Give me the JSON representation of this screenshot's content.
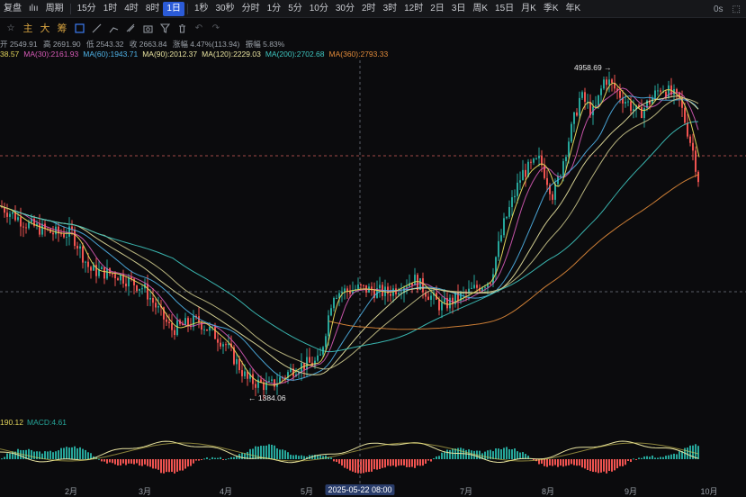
{
  "toolbar": {
    "items": [
      {
        "label": "复盘",
        "active": false
      },
      {
        "label": "ılıı",
        "active": false
      },
      {
        "label": "周期",
        "active": false
      },
      {
        "label": "15分",
        "active": false
      },
      {
        "label": "1时",
        "active": false
      },
      {
        "label": "4时",
        "active": false
      },
      {
        "label": "8时",
        "active": false
      },
      {
        "label": "1日",
        "active": true
      },
      {
        "label": "1秒",
        "active": false
      },
      {
        "label": "30秒",
        "active": false
      },
      {
        "label": "分时",
        "active": false
      },
      {
        "label": "1分",
        "active": false
      },
      {
        "label": "5分",
        "active": false
      },
      {
        "label": "10分",
        "active": false
      },
      {
        "label": "30分",
        "active": false
      },
      {
        "label": "2时",
        "active": false
      },
      {
        "label": "3时",
        "active": false
      },
      {
        "label": "12时",
        "active": false
      },
      {
        "label": "2日",
        "active": false
      },
      {
        "label": "3日",
        "active": false
      },
      {
        "label": "周K",
        "active": false
      },
      {
        "label": "15日",
        "active": false
      },
      {
        "label": "月K",
        "active": false
      },
      {
        "label": "季K",
        "active": false
      },
      {
        "label": "年K",
        "active": false
      }
    ],
    "countdown": "0s"
  },
  "toolbar2": {
    "buttons": [
      {
        "label": "主",
        "icon": "main-indicator"
      },
      {
        "label": "大",
        "icon": "large"
      },
      {
        "label": "筹",
        "icon": "chips"
      }
    ],
    "icons": [
      "crosshair-icon",
      "text-icon",
      "draw-line-icon",
      "measure-icon",
      "camera-icon",
      "filter-icon",
      "trash-icon",
      "undo-icon",
      "redo-icon"
    ]
  },
  "ohlc": {
    "open": "开 2549.91",
    "high": "高 2691.90",
    "low": "低 2543.32",
    "close": "收 2663.84",
    "change": "涨幅 4.47%(113.94)",
    "amplitude": "振幅 5.83%"
  },
  "ma_legend": [
    {
      "text": "38.57",
      "color": "#e0d25a"
    },
    {
      "text": "MA(30):2161.93",
      "color": "#d65ab6"
    },
    {
      "text": "MA(60):1943.71",
      "color": "#4fb3e8"
    },
    {
      "text": "MA(90):2012.37",
      "color": "#e8e3a0"
    },
    {
      "text": "MA(120):2229.03",
      "color": "#e8e3a0"
    },
    {
      "text": "MA(200):2702.68",
      "color": "#3ec6c0"
    },
    {
      "text": "MA(360):2793.33",
      "color": "#e08a3a"
    }
  ],
  "macd_legend": [
    {
      "text": "190.12",
      "color": "#e0d25a"
    },
    {
      "text": "MACD:4.61",
      "color": "#26a69a"
    }
  ],
  "annotations": {
    "high": "4958.69",
    "low": "1384.06"
  },
  "time_axis": {
    "ticks": [
      "2月",
      "3月",
      "4月",
      "5月",
      "7月",
      "8月",
      "9月",
      "10月"
    ],
    "cross_date": "2025-05-22 08:00"
  },
  "colors": {
    "up": "#26a69a",
    "down": "#ef5350",
    "background": "#0b0b0d",
    "active_tab": "#2b5bd7"
  },
  "chart_data": {
    "type": "candlestick",
    "high": 4958.69,
    "low": 1384.06,
    "series": [
      {
        "name": "MA(30)",
        "color": "#d65ab6"
      },
      {
        "name": "MA(60)",
        "color": "#4fb3e8"
      },
      {
        "name": "MA(90)",
        "color": "#e8e3a0"
      },
      {
        "name": "MA(120)",
        "color": "#e8e3a0"
      },
      {
        "name": "MA(200)",
        "color": "#3ec6c0"
      },
      {
        "name": "MA(360)",
        "color": "#e08a3a"
      }
    ]
  }
}
